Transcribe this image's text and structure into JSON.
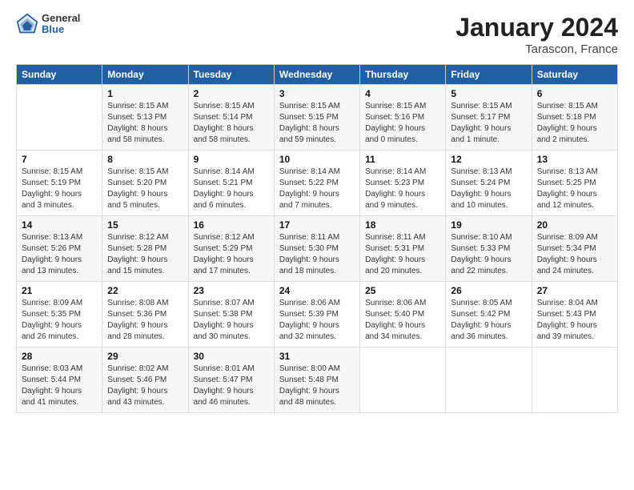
{
  "header": {
    "title": "January 2024",
    "subtitle": "Tarascon, France",
    "logo_general": "General",
    "logo_blue": "Blue"
  },
  "columns": [
    "Sunday",
    "Monday",
    "Tuesday",
    "Wednesday",
    "Thursday",
    "Friday",
    "Saturday"
  ],
  "weeks": [
    [
      {
        "day": "",
        "sunrise": "",
        "sunset": "",
        "daylight": ""
      },
      {
        "day": "1",
        "sunrise": "Sunrise: 8:15 AM",
        "sunset": "Sunset: 5:13 PM",
        "daylight": "Daylight: 8 hours and 58 minutes."
      },
      {
        "day": "2",
        "sunrise": "Sunrise: 8:15 AM",
        "sunset": "Sunset: 5:14 PM",
        "daylight": "Daylight: 8 hours and 58 minutes."
      },
      {
        "day": "3",
        "sunrise": "Sunrise: 8:15 AM",
        "sunset": "Sunset: 5:15 PM",
        "daylight": "Daylight: 8 hours and 59 minutes."
      },
      {
        "day": "4",
        "sunrise": "Sunrise: 8:15 AM",
        "sunset": "Sunset: 5:16 PM",
        "daylight": "Daylight: 9 hours and 0 minutes."
      },
      {
        "day": "5",
        "sunrise": "Sunrise: 8:15 AM",
        "sunset": "Sunset: 5:17 PM",
        "daylight": "Daylight: 9 hours and 1 minute."
      },
      {
        "day": "6",
        "sunrise": "Sunrise: 8:15 AM",
        "sunset": "Sunset: 5:18 PM",
        "daylight": "Daylight: 9 hours and 2 minutes."
      }
    ],
    [
      {
        "day": "7",
        "sunrise": "Sunrise: 8:15 AM",
        "sunset": "Sunset: 5:19 PM",
        "daylight": "Daylight: 9 hours and 3 minutes."
      },
      {
        "day": "8",
        "sunrise": "Sunrise: 8:15 AM",
        "sunset": "Sunset: 5:20 PM",
        "daylight": "Daylight: 9 hours and 5 minutes."
      },
      {
        "day": "9",
        "sunrise": "Sunrise: 8:14 AM",
        "sunset": "Sunset: 5:21 PM",
        "daylight": "Daylight: 9 hours and 6 minutes."
      },
      {
        "day": "10",
        "sunrise": "Sunrise: 8:14 AM",
        "sunset": "Sunset: 5:22 PM",
        "daylight": "Daylight: 9 hours and 7 minutes."
      },
      {
        "day": "11",
        "sunrise": "Sunrise: 8:14 AM",
        "sunset": "Sunset: 5:23 PM",
        "daylight": "Daylight: 9 hours and 9 minutes."
      },
      {
        "day": "12",
        "sunrise": "Sunrise: 8:13 AM",
        "sunset": "Sunset: 5:24 PM",
        "daylight": "Daylight: 9 hours and 10 minutes."
      },
      {
        "day": "13",
        "sunrise": "Sunrise: 8:13 AM",
        "sunset": "Sunset: 5:25 PM",
        "daylight": "Daylight: 9 hours and 12 minutes."
      }
    ],
    [
      {
        "day": "14",
        "sunrise": "Sunrise: 8:13 AM",
        "sunset": "Sunset: 5:26 PM",
        "daylight": "Daylight: 9 hours and 13 minutes."
      },
      {
        "day": "15",
        "sunrise": "Sunrise: 8:12 AM",
        "sunset": "Sunset: 5:28 PM",
        "daylight": "Daylight: 9 hours and 15 minutes."
      },
      {
        "day": "16",
        "sunrise": "Sunrise: 8:12 AM",
        "sunset": "Sunset: 5:29 PM",
        "daylight": "Daylight: 9 hours and 17 minutes."
      },
      {
        "day": "17",
        "sunrise": "Sunrise: 8:11 AM",
        "sunset": "Sunset: 5:30 PM",
        "daylight": "Daylight: 9 hours and 18 minutes."
      },
      {
        "day": "18",
        "sunrise": "Sunrise: 8:11 AM",
        "sunset": "Sunset: 5:31 PM",
        "daylight": "Daylight: 9 hours and 20 minutes."
      },
      {
        "day": "19",
        "sunrise": "Sunrise: 8:10 AM",
        "sunset": "Sunset: 5:33 PM",
        "daylight": "Daylight: 9 hours and 22 minutes."
      },
      {
        "day": "20",
        "sunrise": "Sunrise: 8:09 AM",
        "sunset": "Sunset: 5:34 PM",
        "daylight": "Daylight: 9 hours and 24 minutes."
      }
    ],
    [
      {
        "day": "21",
        "sunrise": "Sunrise: 8:09 AM",
        "sunset": "Sunset: 5:35 PM",
        "daylight": "Daylight: 9 hours and 26 minutes."
      },
      {
        "day": "22",
        "sunrise": "Sunrise: 8:08 AM",
        "sunset": "Sunset: 5:36 PM",
        "daylight": "Daylight: 9 hours and 28 minutes."
      },
      {
        "day": "23",
        "sunrise": "Sunrise: 8:07 AM",
        "sunset": "Sunset: 5:38 PM",
        "daylight": "Daylight: 9 hours and 30 minutes."
      },
      {
        "day": "24",
        "sunrise": "Sunrise: 8:06 AM",
        "sunset": "Sunset: 5:39 PM",
        "daylight": "Daylight: 9 hours and 32 minutes."
      },
      {
        "day": "25",
        "sunrise": "Sunrise: 8:06 AM",
        "sunset": "Sunset: 5:40 PM",
        "daylight": "Daylight: 9 hours and 34 minutes."
      },
      {
        "day": "26",
        "sunrise": "Sunrise: 8:05 AM",
        "sunset": "Sunset: 5:42 PM",
        "daylight": "Daylight: 9 hours and 36 minutes."
      },
      {
        "day": "27",
        "sunrise": "Sunrise: 8:04 AM",
        "sunset": "Sunset: 5:43 PM",
        "daylight": "Daylight: 9 hours and 39 minutes."
      }
    ],
    [
      {
        "day": "28",
        "sunrise": "Sunrise: 8:03 AM",
        "sunset": "Sunset: 5:44 PM",
        "daylight": "Daylight: 9 hours and 41 minutes."
      },
      {
        "day": "29",
        "sunrise": "Sunrise: 8:02 AM",
        "sunset": "Sunset: 5:46 PM",
        "daylight": "Daylight: 9 hours and 43 minutes."
      },
      {
        "day": "30",
        "sunrise": "Sunrise: 8:01 AM",
        "sunset": "Sunset: 5:47 PM",
        "daylight": "Daylight: 9 hours and 46 minutes."
      },
      {
        "day": "31",
        "sunrise": "Sunrise: 8:00 AM",
        "sunset": "Sunset: 5:48 PM",
        "daylight": "Daylight: 9 hours and 48 minutes."
      },
      {
        "day": "",
        "sunrise": "",
        "sunset": "",
        "daylight": ""
      },
      {
        "day": "",
        "sunrise": "",
        "sunset": "",
        "daylight": ""
      },
      {
        "day": "",
        "sunrise": "",
        "sunset": "",
        "daylight": ""
      }
    ]
  ]
}
